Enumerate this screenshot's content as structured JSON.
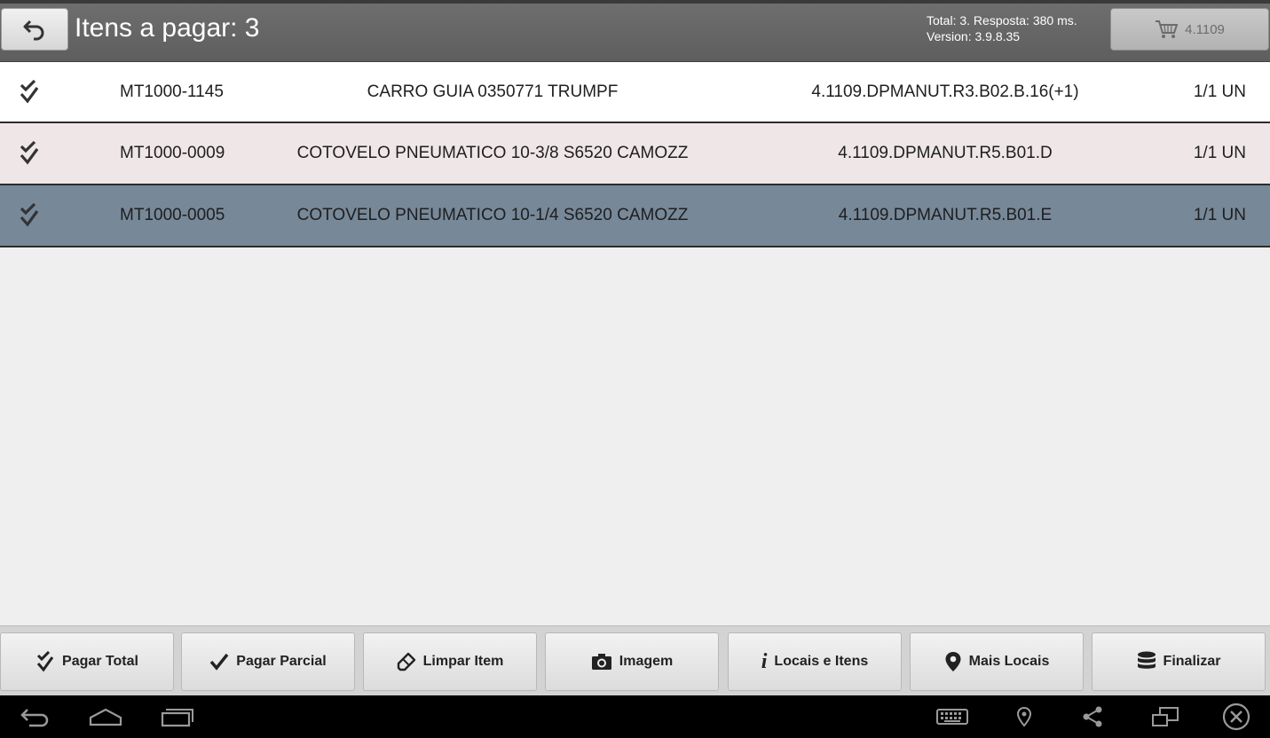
{
  "header": {
    "title": "Itens a pagar: 3",
    "stats_line1": "Total: 3. Resposta: 380 ms.",
    "stats_line2": "Version: 3.9.8.35",
    "cart_label": "4.1109",
    "back_icon": "back-arrow-icon",
    "cart_icon": "cart-icon"
  },
  "items": [
    {
      "code": "MT1000-1145",
      "description": "CARRO GUIA 0350771 TRUMPF",
      "location": "4.1109.DPMANUT.R3.B02.B.16(+1)",
      "qty": "1/1 UN"
    },
    {
      "code": "MT1000-0009",
      "description": "COTOVELO PNEUMATICO 10-3/8 S6520 CAMOZZ",
      "location": "4.1109.DPMANUT.R5.B01.D",
      "qty": "1/1 UN"
    },
    {
      "code": "MT1000-0005",
      "description": "COTOVELO PNEUMATICO 10-1/4 S6520 CAMOZZ",
      "location": "4.1109.DPMANUT.R5.B01.E",
      "qty": "1/1 UN"
    }
  ],
  "actions": [
    {
      "label": "Pagar Total",
      "icon": "double-check-icon"
    },
    {
      "label": "Pagar Parcial",
      "icon": "check-icon"
    },
    {
      "label": "Limpar Item",
      "icon": "eraser-icon"
    },
    {
      "label": "Imagem",
      "icon": "camera-icon"
    },
    {
      "label": "Locais e Itens",
      "icon": "info-icon"
    },
    {
      "label": "Mais Locais",
      "icon": "map-pin-icon"
    },
    {
      "label": "Finalizar",
      "icon": "database-icon"
    }
  ],
  "colors": {
    "header_bg": "#666666",
    "row_odd": "#ffffff",
    "row_even": "#efe7e7",
    "row_selected": "#778899",
    "navbar_bg": "#000000"
  }
}
